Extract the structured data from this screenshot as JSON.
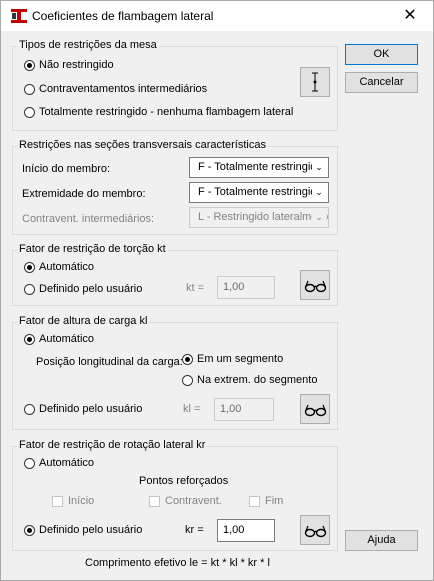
{
  "window": {
    "title": "Coeficientes de flambagem lateral",
    "close_glyph": "✕"
  },
  "buttons": {
    "ok": "OK",
    "cancel": "Cancelar",
    "help": "Ajuda"
  },
  "restr_mesa": {
    "title": "Tipos de restrições da mesa",
    "options": [
      "Não restringido",
      "Contraventamentos intermediários",
      "Totalmente restringido - nenhuma flambagem lateral"
    ],
    "selected": 0
  },
  "restr_secoes": {
    "title": "Restrições nas seções transversais características",
    "inicio_label": "Início do membro:",
    "inicio_value": "F - Totalmente restringido",
    "extremidade_label": "Extremidade do membro:",
    "extremidade_value": "F - Totalmente restringido",
    "contravent_label": "Contravent. intermediários:",
    "contravent_value": "L - Restringido lateralmente"
  },
  "kt": {
    "title": "Fator de restrição de torção kt",
    "auto": "Automático",
    "user": "Definido pelo usuário",
    "field_label": "kt =",
    "value": "1,00"
  },
  "kl": {
    "title": "Fator de altura de carga kl",
    "auto": "Automático",
    "pos_label": "Posição longitudinal da carga:",
    "pos_opt1": "Em um segmento",
    "pos_opt2": "Na extrem. do segmento",
    "user": "Definido pelo usuário",
    "field_label": "kl =",
    "value": "1,00"
  },
  "kr": {
    "title": "Fator de restrição de rotação lateral kr",
    "auto": "Automático",
    "pontos_label": "Pontos reforçados",
    "chk_inicio": "Início",
    "chk_contravent": "Contravent.",
    "chk_fim": "Fim",
    "user": "Definido pelo usuário",
    "field_label": "kr =",
    "value": "1,00"
  },
  "footer": {
    "formula": "Comprimento efetivo le = kt * kl * kr * l"
  },
  "icons": [
    "app-icon",
    "close-icon",
    "member-restraint-icon",
    "glasses-icon"
  ]
}
